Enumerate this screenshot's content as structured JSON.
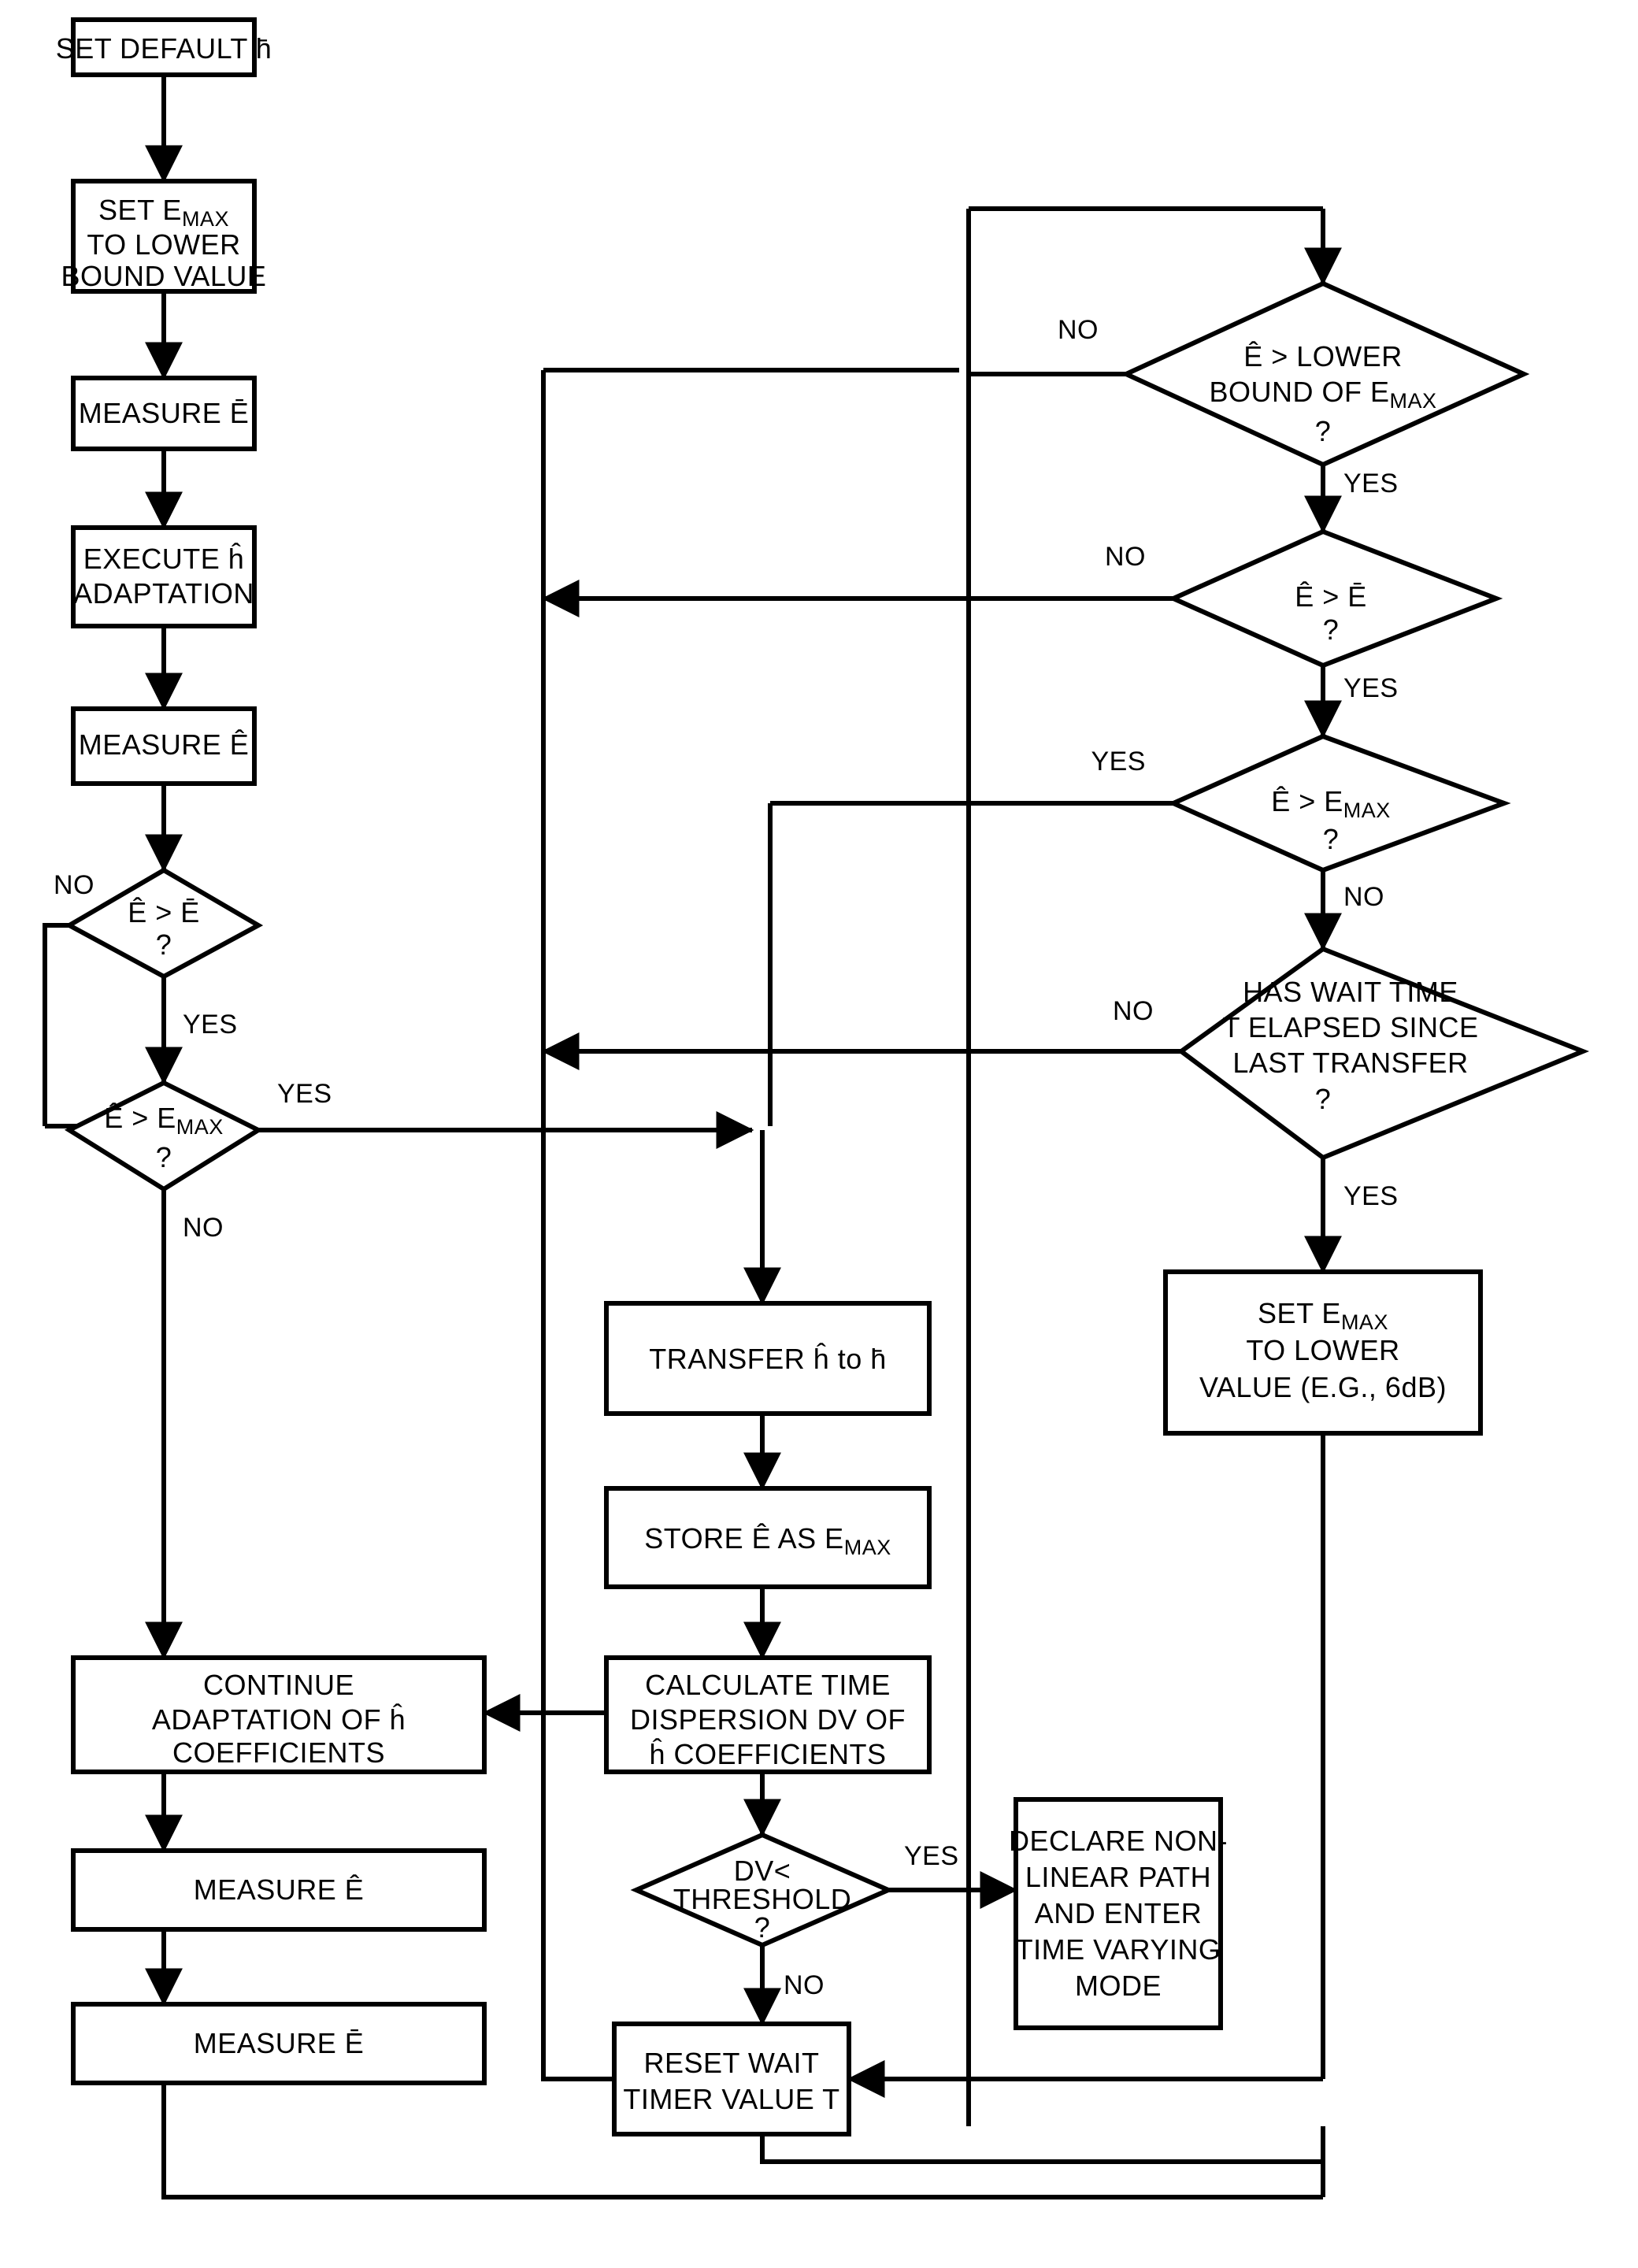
{
  "diagram": {
    "title": "Adaptive filter control flowchart",
    "line_color": "#000000",
    "background_color": "#ffffff"
  },
  "nodes": [
    {
      "id": "set_default_h",
      "type": "process",
      "lines": [
        "SET DEFAULT h̄"
      ]
    },
    {
      "id": "set_emax_lower_bound",
      "type": "process",
      "lines": [
        "SET E",
        "TO LOWER",
        "BOUND VALUE"
      ],
      "sub": "MAX",
      "sub_line": 0,
      "prefix": "SET E"
    },
    {
      "id": "measure_ebar_1",
      "type": "process",
      "lines": [
        "MEASURE Ē"
      ]
    },
    {
      "id": "execute_h_adapt",
      "type": "process",
      "lines": [
        "EXECUTE ĥ",
        "ADAPTATION"
      ]
    },
    {
      "id": "measure_ehat_1",
      "type": "process",
      "lines": [
        "MEASURE Ê"
      ]
    },
    {
      "id": "dec_ehat_gt_ebar_L",
      "type": "decision",
      "lines": [
        "Ê > Ē",
        "?"
      ]
    },
    {
      "id": "dec_ehat_gt_emax_L",
      "type": "decision",
      "lines": [
        "Ê > E",
        "?"
      ],
      "sub": "MAX"
    },
    {
      "id": "continue_adapt",
      "type": "process",
      "lines": [
        "CONTINUE",
        "ADAPTATION OF ĥ",
        "COEFFICIENTS"
      ]
    },
    {
      "id": "measure_ehat_2",
      "type": "process",
      "lines": [
        "MEASURE Ê"
      ]
    },
    {
      "id": "measure_ebar_2",
      "type": "process",
      "lines": [
        "MEASURE Ē"
      ]
    },
    {
      "id": "dec_ehat_gt_lower_bound",
      "type": "decision",
      "lines": [
        "Ê > LOWER",
        "BOUND OF E",
        "?"
      ],
      "sub": "MAX"
    },
    {
      "id": "dec_ehat_gt_ebar_R",
      "type": "decision",
      "lines": [
        "Ê > Ē",
        "?"
      ]
    },
    {
      "id": "dec_ehat_gt_emax_R",
      "type": "decision",
      "lines": [
        "Ê > E",
        "?"
      ],
      "sub": "MAX"
    },
    {
      "id": "dec_wait_time",
      "type": "decision",
      "lines": [
        "HAS WAIT TIME",
        "T ELAPSED SINCE",
        "LAST TRANSFER",
        "?"
      ]
    },
    {
      "id": "set_emax_lower_value",
      "type": "process",
      "lines": [
        "SET E",
        "TO LOWER",
        "VALUE (E.G., 6dB)"
      ],
      "sub": "MAX"
    },
    {
      "id": "transfer_h",
      "type": "process",
      "lines": [
        "TRANSFER ĥ to h̄"
      ]
    },
    {
      "id": "store_ehat",
      "type": "process",
      "lines": [
        "STORE Ê AS E",
        "MAX"
      ],
      "sub": "MAX"
    },
    {
      "id": "calc_dispersion",
      "type": "process",
      "lines": [
        "CALCULATE TIME",
        "DISPERSION DV OF",
        "ĥ COEFFICIENTS"
      ]
    },
    {
      "id": "dec_dv_threshold",
      "type": "decision",
      "lines": [
        "DV<",
        "THRESHOLD",
        "?"
      ]
    },
    {
      "id": "declare_nonlinear",
      "type": "process",
      "lines": [
        "DECLARE NON-",
        "LINEAR PATH",
        "AND ENTER",
        "TIME VARYING",
        "MODE"
      ]
    },
    {
      "id": "reset_wait_timer",
      "type": "process",
      "lines": [
        "RESET WAIT",
        "TIMER VALUE T"
      ]
    }
  ],
  "text": {
    "set_default_h": "SET DEFAULT h̄",
    "set_emax_lb_l1": "SET E",
    "set_emax_lb_sub": "MAX",
    "set_emax_lb_l2": "TO LOWER",
    "set_emax_lb_l3": "BOUND VALUE",
    "measure_ebar": "MEASURE Ē",
    "execute_l1": "EXECUTE ĥ",
    "execute_l2": "ADAPTATION",
    "measure_ehat": "MEASURE Ê",
    "ehat_gt_ebar": "Ê > Ē",
    "question": "?",
    "ehat_gt_e": "Ê > E",
    "max_sub": "MAX",
    "continue_l1": "CONTINUE",
    "continue_l2": "ADAPTATION OF ĥ",
    "continue_l3": "COEFFICIENTS",
    "lower_l1": "Ê > LOWER",
    "lower_l2": "BOUND OF E",
    "wait_l1": "HAS WAIT TIME",
    "wait_l2": "T ELAPSED SINCE",
    "wait_l3": "LAST TRANSFER",
    "set_emax_lv_l1": "SET E",
    "set_emax_lv_l2": "TO LOWER",
    "set_emax_lv_l3": "VALUE (E.G., 6dB)",
    "transfer": "TRANSFER ĥ to h̄",
    "store_ehat": "STORE Ê AS E",
    "calc_l1": "CALCULATE TIME",
    "calc_l2": "DISPERSION DV OF",
    "calc_l3": "ĥ COEFFICIENTS",
    "dv_l1": "DV<",
    "dv_l2": "THRESHOLD",
    "declare_l1": "DECLARE NON-",
    "declare_l2": "LINEAR PATH",
    "declare_l3": "AND ENTER",
    "declare_l4": "TIME VARYING",
    "declare_l5": "MODE",
    "reset_l1": "RESET WAIT",
    "reset_l2": "TIMER VALUE T"
  },
  "edge_labels": {
    "yes": "YES",
    "no": "NO",
    "no_left_ebar": "NO",
    "yes_left_ebar": "YES",
    "yes_left_emax": "YES",
    "no_left_emax": "NO",
    "no_lower_bound": "NO",
    "yes_lower_bound": "YES",
    "no_ebar_right": "NO",
    "yes_ebar_right": "YES",
    "yes_emax_right": "YES",
    "no_emax_right": "NO",
    "no_wait": "NO",
    "yes_wait": "YES",
    "yes_dv": "YES",
    "no_dv": "NO"
  }
}
